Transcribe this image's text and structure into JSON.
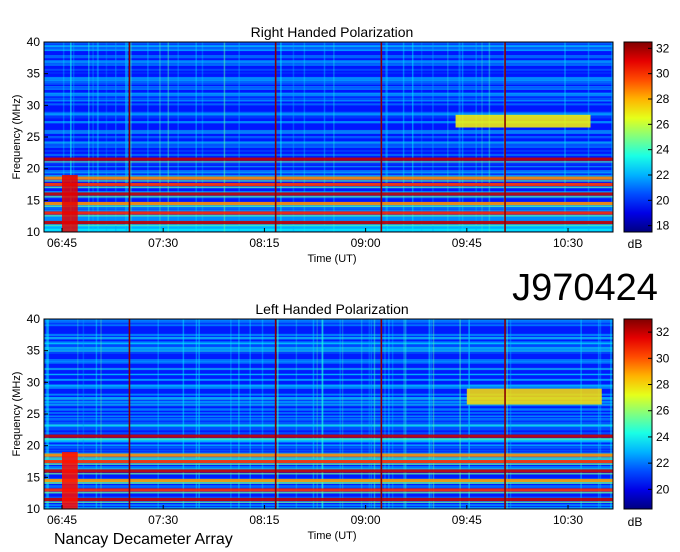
{
  "date_code": "J970424",
  "instrument": "Nancay Decameter Array",
  "chart_data": [
    {
      "type": "heatmap",
      "title": "Right Handed Polarization",
      "xlabel": "Time (UT)",
      "ylabel": "Frequency (MHz)",
      "x_ticks": [
        "06:45",
        "07:30",
        "08:15",
        "09:00",
        "09:45",
        "10:30"
      ],
      "y_ticks": [
        10,
        15,
        20,
        25,
        30,
        35,
        40
      ],
      "ylim": [
        10,
        40
      ],
      "colorbar": {
        "unit": "dB",
        "ticks": [
          18,
          20,
          22,
          24,
          26,
          28,
          30,
          32
        ],
        "range": [
          17.5,
          32.5
        ]
      },
      "features": {
        "vertical_lines_utc": [
          "07:15",
          "08:20",
          "09:07",
          "10:02"
        ],
        "horizontal_bands_mhz": [
          11.5,
          13.0,
          14.5,
          16.0,
          17.5,
          18.5,
          21.5
        ],
        "emission_patches": [
          {
            "t0": "06:45",
            "t1": "06:52",
            "f0": 10,
            "f1": 19,
            "level": 31
          },
          {
            "t0": "09:40",
            "t1": "10:40",
            "f0": 26.5,
            "f1": 28.5,
            "level": 27
          }
        ]
      }
    },
    {
      "type": "heatmap",
      "title": "Left Handed Polarization",
      "xlabel": "Time (UT)",
      "ylabel": "Frequency (MHz)",
      "x_ticks": [
        "06:45",
        "07:30",
        "08:15",
        "09:00",
        "09:45",
        "10:30"
      ],
      "y_ticks": [
        10,
        15,
        20,
        25,
        30,
        35,
        40
      ],
      "ylim": [
        10,
        40
      ],
      "colorbar": {
        "unit": "dB",
        "ticks": [
          20,
          22,
          24,
          26,
          28,
          30,
          32
        ],
        "range": [
          18.5,
          33
        ]
      },
      "features": {
        "vertical_lines_utc": [
          "07:15",
          "08:20",
          "09:07",
          "10:02"
        ],
        "horizontal_bands_mhz": [
          11.5,
          13.0,
          14.5,
          16.0,
          17.5,
          18.5,
          21.5
        ],
        "emission_patches": [
          {
            "t0": "06:45",
            "t1": "06:52",
            "f0": 10,
            "f1": 19,
            "level": 31
          },
          {
            "t0": "09:45",
            "t1": "10:45",
            "f0": 26.5,
            "f1": 29,
            "level": 28
          }
        ]
      }
    }
  ]
}
